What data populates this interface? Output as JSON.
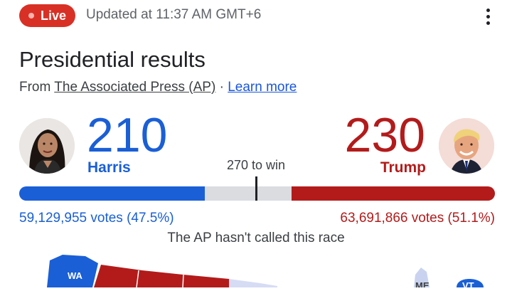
{
  "header": {
    "live_label": "Live",
    "updated": "Updated at 11:37 AM GMT+6",
    "more_icon": "more-vert-icon"
  },
  "title": "Presidential results",
  "source": {
    "prefix": "From ",
    "link": "The Associated Press (AP)",
    "separator": " · ",
    "learn_more": "Learn more"
  },
  "candidates": {
    "harris": {
      "electoral_votes": "210",
      "name": "Harris",
      "votes": "59,129,955 votes (47.5%)",
      "color": "#1a5fd6"
    },
    "trump": {
      "electoral_votes": "230",
      "name": "Trump",
      "votes": "63,691,866 votes (51.1%)",
      "color": "#b31b1b"
    }
  },
  "to_win": "270 to win",
  "progress": {
    "total": 538,
    "harris": 210,
    "trump": 230,
    "threshold": 270
  },
  "status": "The AP hasn't called this race",
  "map": {
    "labels": {
      "wa": "WA",
      "me": "ME",
      "vt": "VT"
    }
  }
}
